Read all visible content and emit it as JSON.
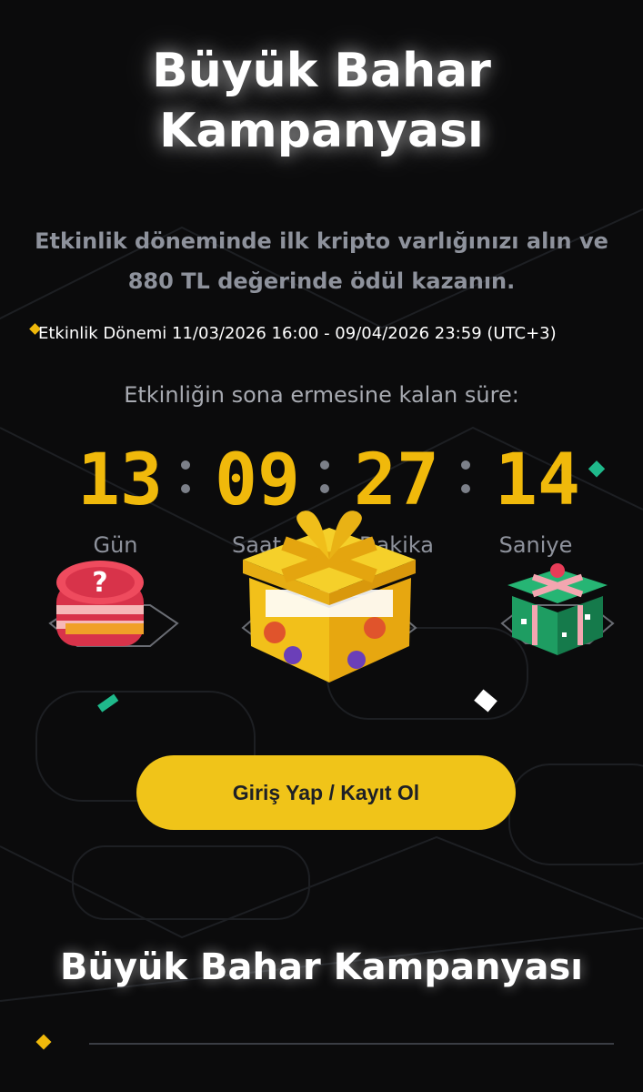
{
  "hero": {
    "title_line1": "Büyük Bahar",
    "title_line2": "Kampanyası",
    "subtitle_line1": "Etkinlik döneminde ilk kripto varlığınızı alın ve",
    "subtitle_line2": "880 TL değerinde ödül kazanın.",
    "period": "Etkinlik Dönemi 11/03/2026 16:00 - 09/04/2026 23:59 (UTC+3)"
  },
  "countdown": {
    "label": "Etkinliğin sona ermesine kalan süre:",
    "days": "13",
    "hours": "09",
    "minutes": "27",
    "seconds": "14",
    "days_label": "Gün",
    "hours_label": "Saat",
    "minutes_label": "Dakika",
    "seconds_label": "Saniye"
  },
  "cta": {
    "label": "Giriş Yap / Kayıt Ol"
  },
  "section": {
    "title": "Büyük Bahar Kampanyası"
  },
  "colors": {
    "accent": "#f0b90b",
    "background": "#0b0b0c",
    "button": "#f0c419"
  },
  "icons": [
    "mystery-token-icon",
    "gift-box-icon",
    "green-gift-box-icon",
    "diamond-bullet-icon"
  ]
}
